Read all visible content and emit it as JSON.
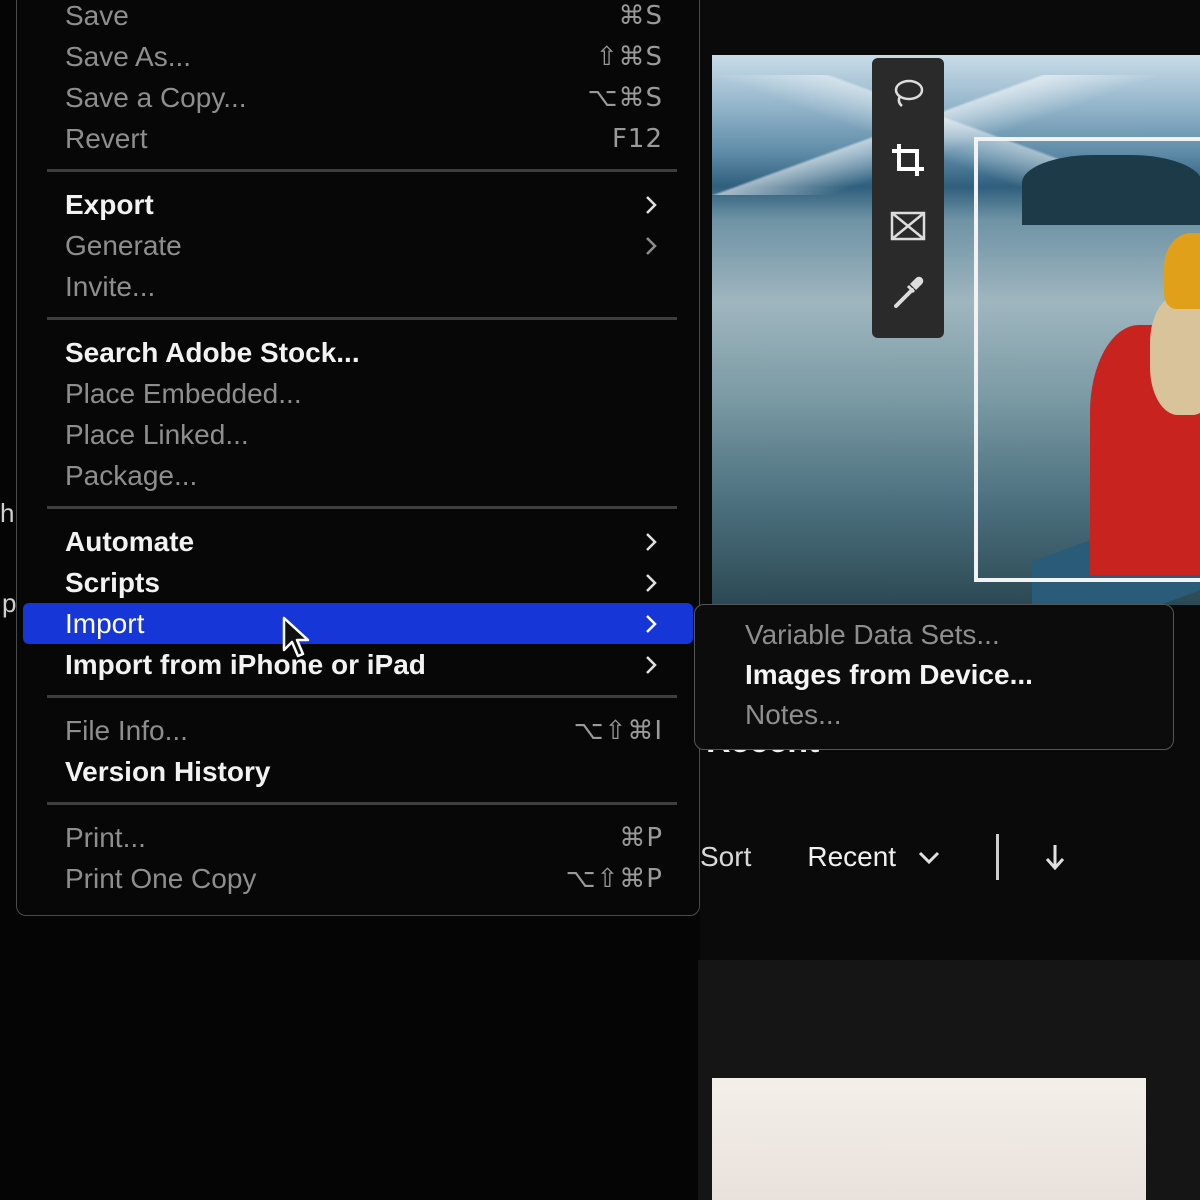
{
  "file_menu": {
    "items": [
      {
        "label": "Save",
        "shortcut": "⌘S",
        "state": "disabled"
      },
      {
        "label": "Save As...",
        "shortcut": "⇧⌘S",
        "state": "disabled"
      },
      {
        "label": "Save a Copy...",
        "shortcut": "⌥⌘S",
        "state": "disabled"
      },
      {
        "label": "Revert",
        "shortcut": "F12",
        "state": "disabled"
      },
      {
        "label": "Export",
        "state": "enabled",
        "submenu": true
      },
      {
        "label": "Generate",
        "state": "disabled",
        "submenu": true
      },
      {
        "label": "Invite...",
        "state": "disabled"
      },
      {
        "label": "Search Adobe Stock...",
        "state": "enabled"
      },
      {
        "label": "Place Embedded...",
        "state": "disabled"
      },
      {
        "label": "Place Linked...",
        "state": "disabled"
      },
      {
        "label": "Package...",
        "state": "disabled"
      },
      {
        "label": "Automate",
        "state": "enabled",
        "submenu": true
      },
      {
        "label": "Scripts",
        "state": "enabled",
        "submenu": true
      },
      {
        "label": "Import",
        "state": "highlighted",
        "submenu": true
      },
      {
        "label": "Import from iPhone or iPad",
        "state": "enabled",
        "submenu": true
      },
      {
        "label": "File Info...",
        "shortcut": "⌥⇧⌘I",
        "state": "disabled"
      },
      {
        "label": "Version History",
        "state": "enabled"
      },
      {
        "label": "Print...",
        "shortcut": "⌘P",
        "state": "disabled"
      },
      {
        "label": "Print One Copy",
        "shortcut": "⌥⇧⌘P",
        "state": "disabled"
      }
    ]
  },
  "import_submenu": {
    "items": [
      {
        "label": "Variable Data Sets...",
        "state": "disabled"
      },
      {
        "label": "Images from Device...",
        "state": "enabled"
      },
      {
        "label": "Notes...",
        "state": "disabled"
      }
    ]
  },
  "toolbar": {
    "tools": [
      "lasso-icon",
      "crop-icon",
      "frame-icon",
      "eyedropper-icon"
    ]
  },
  "files_panel": {
    "heading": "Recent",
    "sort_label": "Sort",
    "sort_value": "Recent"
  },
  "edge_text": {
    "left_top": "h",
    "left_bottom": "p"
  },
  "colors": {
    "highlight": "#1736d8",
    "menu_background": "#070707"
  }
}
